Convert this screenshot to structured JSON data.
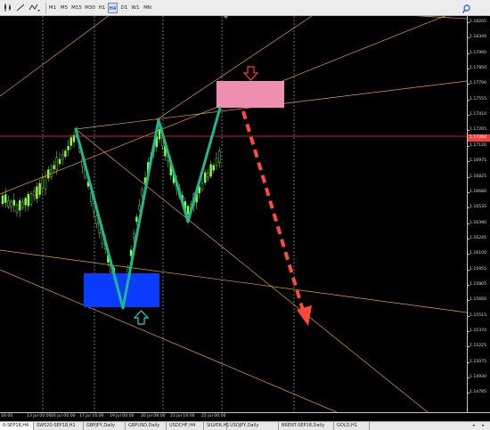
{
  "toolbar": {
    "timeframes": [
      "M1",
      "M5",
      "M15",
      "M30",
      "H1",
      "H4",
      "D1",
      "W1",
      "MN"
    ],
    "active_timeframe": "H4"
  },
  "price_axis": {
    "labels": [
      "1.18205",
      "1.18340",
      "1.17995",
      "1.17850",
      "1.17700",
      "1.17555",
      "1.17410",
      "1.17265",
      "1.17120",
      "1.16975",
      "1.16825",
      "1.16680",
      "1.16535",
      "1.16390",
      "1.16245",
      "1.16100",
      "1.15955",
      "1.15805",
      "1.15660",
      "1.15515",
      "1.15370",
      "1.15225",
      "1.15075",
      "1.14930",
      "1.14785"
    ],
    "current_price": "1.17264"
  },
  "time_axis": {
    "labels": [
      "16:00",
      "13 Jul 00:00",
      "16 Jul 00:00",
      "17 Jul 16:00",
      "19 Jul 00:00",
      "20 Jul 08:00",
      "23 Jul 16:00",
      "25 Jul 00:00"
    ]
  },
  "symbol_tabs": [
    "0-SEP18,H4",
    "SW520-SEP18,H1",
    "GBPJPY,Daily",
    "GBPUSD,Daily",
    "USDCHF,H4",
    "SILVER,H1",
    "USDJPY,Daily",
    "BRENT-SEP18,Daily",
    "GOLD,H1"
  ],
  "colors": {
    "zigzag": "#1fb88e",
    "arrow": "#ff4a3a",
    "sell_zone": "#ee8fb2",
    "buy_zone": "#0a3cff",
    "trendlines": "#e8a030",
    "current_price_line": "#ff3b3b",
    "bull_candle": "#8dff3a",
    "up_arrow": "#2fd0c0",
    "down_arrow": "#ff3b3b"
  },
  "icons": {
    "search": "magnifier-icon",
    "down_arrow": "down-arrow-icon",
    "up_arrow": "up-arrow-icon"
  }
}
